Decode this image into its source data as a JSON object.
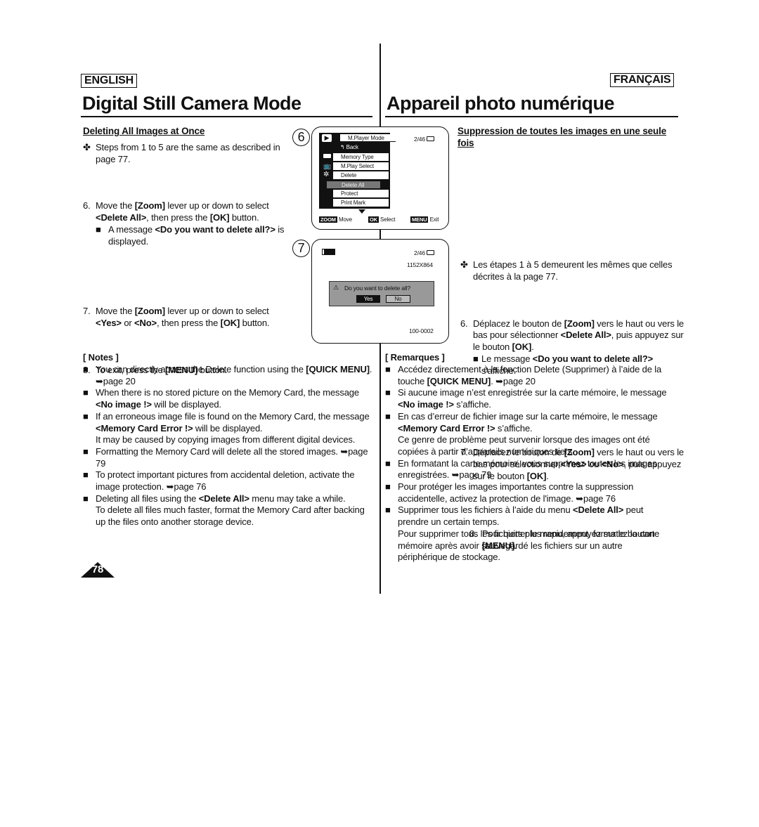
{
  "en": {
    "lang": "ENGLISH",
    "title": "Digital Still Camera Mode",
    "heading": "Deleting All Images at Once",
    "intro": [
      {
        "t": "Steps from 1 to 5 are the same as described in page 77."
      }
    ],
    "step6": [
      {
        "t": "Move the "
      },
      {
        "t": "[Zoom]",
        "b": 1
      },
      {
        "t": " lever up or down to select "
      },
      {
        "t": "<Delete All>",
        "b": 1
      },
      {
        "t": ", then press the "
      },
      {
        "t": "[OK]",
        "b": 1
      },
      {
        "t": " button."
      }
    ],
    "step6sub": [
      {
        "t": "A message "
      },
      {
        "t": "<Do you want to delete all?>",
        "b": 1
      },
      {
        "t": " is displayed."
      }
    ],
    "step7": [
      {
        "t": "Move the "
      },
      {
        "t": "[Zoom]",
        "b": 1
      },
      {
        "t": " lever up or down to select "
      },
      {
        "t": "<Yes>",
        "b": 1
      },
      {
        "t": " or "
      },
      {
        "t": "<No>",
        "b": 1
      },
      {
        "t": ", then press the "
      },
      {
        "t": "[OK]",
        "b": 1
      },
      {
        "t": " button."
      }
    ],
    "step8": [
      {
        "t": "To exit, press the "
      },
      {
        "t": "[MENU]",
        "b": 1
      },
      {
        "t": " button."
      }
    ],
    "notes_label": "[ Notes ]",
    "notes": [
      [
        {
          "t": "You can directly access the Delete function using the "
        },
        {
          "t": "[QUICK MENU]",
          "b": 1
        },
        {
          "t": ". ➥page 20"
        }
      ],
      [
        {
          "t": "When there is no stored picture on the Memory Card, the message "
        },
        {
          "t": "<No image !>",
          "b": 1
        },
        {
          "t": " will be displayed."
        }
      ],
      [
        {
          "t": "If an erroneous image file is found on the Memory Card, the message "
        },
        {
          "t": "<Memory Card Error !>",
          "b": 1
        },
        {
          "t": " will be displayed."
        },
        {
          "t": "\nIt may be caused by copying images from different digital devices."
        }
      ],
      [
        {
          "t": "Formatting the Memory Card will delete all the stored images. ➥page 79"
        }
      ],
      [
        {
          "t": "To protect important pictures from accidental deletion, activate the image protection. ➥page 76"
        }
      ],
      [
        {
          "t": "Deleting all files using the "
        },
        {
          "t": "<Delete All>",
          "b": 1
        },
        {
          "t": " menu may take a while."
        },
        {
          "t": "\nTo delete all files much faster, format the Memory Card after backing up the files onto another storage device."
        }
      ]
    ]
  },
  "fr": {
    "lang": "FRANÇAIS",
    "title": "Appareil photo numérique",
    "heading": "Suppression de toutes les images en une seule fois",
    "intro": [
      {
        "t": "Les étapes 1 à 5 demeurent les mêmes que celles décrites à la page 77."
      }
    ],
    "step6": [
      {
        "t": "Déplacez le bouton de "
      },
      {
        "t": "[Zoom]",
        "b": 1
      },
      {
        "t": " vers le haut ou vers le bas pour sélectionner "
      },
      {
        "t": "<Delete All>",
        "b": 1
      },
      {
        "t": ", puis appuyez sur le bouton "
      },
      {
        "t": "[OK]",
        "b": 1
      },
      {
        "t": "."
      }
    ],
    "step6sub": [
      {
        "t": "Le message "
      },
      {
        "t": "<Do you want to delete all?>",
        "b": 1
      },
      {
        "t": " s'affiche."
      }
    ],
    "step7": [
      {
        "t": "Déplacez le bouton de "
      },
      {
        "t": "[Zoom]",
        "b": 1
      },
      {
        "t": " vers le haut ou vers le bas pour sélectionner "
      },
      {
        "t": "<Yes>",
        "b": 1
      },
      {
        "t": " ou "
      },
      {
        "t": "<No>",
        "b": 1
      },
      {
        "t": ", puis appuyez sur le bouton "
      },
      {
        "t": "[OK]",
        "b": 1
      },
      {
        "t": "."
      }
    ],
    "step8": [
      {
        "t": "Pour quitter le menu, appuyez sur le bouton "
      },
      {
        "t": "[MENU]",
        "b": 1
      },
      {
        "t": "."
      }
    ],
    "notes_label": "[ Remarques ]",
    "notes": [
      [
        {
          "t": "Accédez directement à la fonction Delete (Supprimer) à l’aide de la touche "
        },
        {
          "t": "[QUICK MENU]",
          "b": 1
        },
        {
          "t": ". ➥page 20"
        }
      ],
      [
        {
          "t": "Si aucune image n’est enregistrée sur la carte mémoire, le message "
        },
        {
          "t": "<No image !>",
          "b": 1
        },
        {
          "t": " s’affiche."
        }
      ],
      [
        {
          "t": "En cas d’erreur de fichier image sur la carte mémoire, le message "
        },
        {
          "t": "<Memory Card Error !>",
          "b": 1
        },
        {
          "t": " s’affiche."
        },
        {
          "t": "\nCe genre de problème peut survenir lorsque des images ont été copiées à partir d’appareils numériques tiers."
        }
      ],
      [
        {
          "t": "En formatant la carte mémoire, vous supprimez toutes les images enregistrées. ➥page 79"
        }
      ],
      [
        {
          "t": "Pour protéger les images importantes contre la suppression accidentelle, activez la protection de l'image. ➥page 76"
        }
      ],
      [
        {
          "t": "Supprimer tous les fichiers à l’aide du menu "
        },
        {
          "t": "<Delete All>",
          "b": 1
        },
        {
          "t": " peut prendre un certain temps."
        },
        {
          "t": "\nPour supprimer tous les fichiers plus rapidement, formatez la carte mémoire après avoir sauvegardé les fichiers sur un autre périphérique de stockage."
        }
      ]
    ]
  },
  "screen6": {
    "num": "6",
    "mode": "M.Player Mode",
    "counter": "2/46",
    "back": "Back",
    "items": [
      "Memory Type",
      "M.Play Select",
      "Delete",
      "Delete All",
      "Protect",
      "Print Mark"
    ],
    "selected": "Delete All",
    "zoom_key": "ZOOM",
    "zoom_label": "Move",
    "ok_key": "OK",
    "ok_label": "Select",
    "menu_key": "MENU",
    "menu_label": "Exit"
  },
  "screen7": {
    "num": "7",
    "counter": "2/46",
    "resolution": "1152X864",
    "message": "Do you want to delete all?",
    "yes": "Yes",
    "no": "No",
    "file": "100-0002"
  },
  "page_number": "78"
}
